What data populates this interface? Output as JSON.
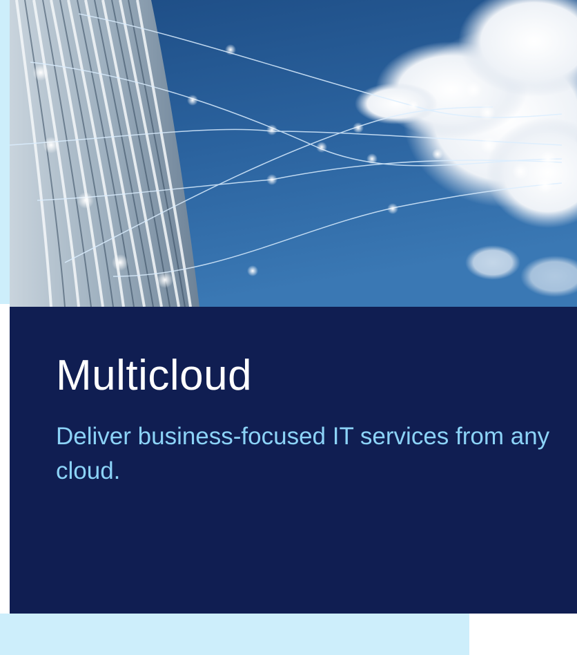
{
  "card": {
    "title": "Multicloud",
    "tagline": "Deliver business-focused IT services from any cloud."
  },
  "colors": {
    "panel_bg": "#101e52",
    "title": "#ffffff",
    "tagline": "#8cd3f7",
    "accent_bg": "#cdeefb"
  },
  "hero": {
    "icon": "building-cloud-network-image"
  }
}
